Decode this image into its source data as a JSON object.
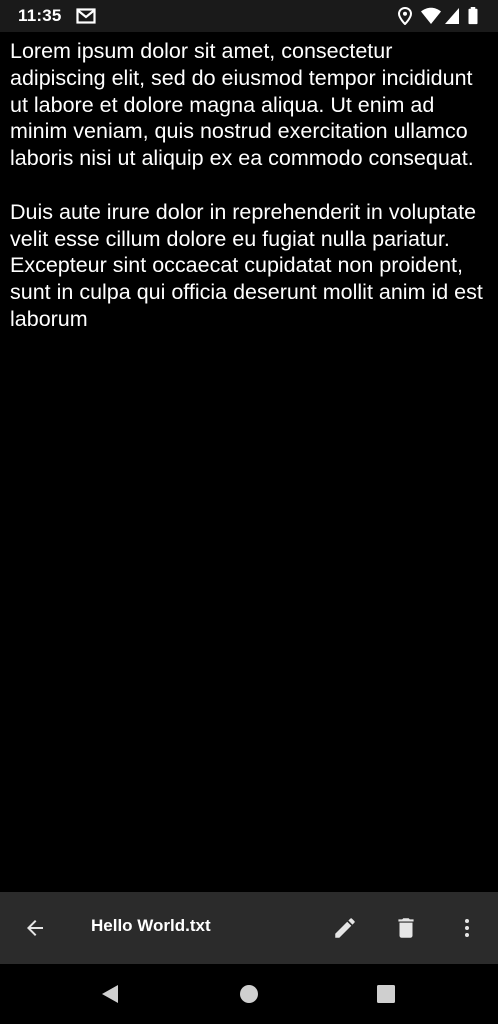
{
  "status_bar": {
    "time": "11:35",
    "icons": [
      "gmail-icon",
      "location-icon",
      "wifi-icon",
      "signal-icon",
      "battery-icon"
    ]
  },
  "document": {
    "paragraphs": [
      "Lorem ipsum dolor sit amet, consectetur adipiscing elit, sed do eiusmod tempor incididunt ut labore et dolore magna aliqua. Ut enim ad minim veniam, quis nostrud exercitation ullamco laboris nisi ut aliquip ex ea commodo consequat.",
      "Duis aute irure dolor in reprehenderit in voluptate velit esse cillum dolore eu fugiat nulla pariatur. Excepteur sint occaecat cupidatat non proident, sunt in culpa qui officia deserunt mollit anim id est laborum"
    ]
  },
  "app_bar": {
    "file_name": "Hello World.txt",
    "icons": [
      "back-arrow-icon",
      "edit-pencil-icon",
      "delete-trash-icon",
      "more-vert-icon"
    ]
  },
  "nav_bar": {
    "icons": [
      "back-triangle-icon",
      "home-circle-icon",
      "recents-square-icon"
    ]
  },
  "colors": {
    "background": "#000000",
    "status_bar": "#1a1a1a",
    "app_bar": "#2b2b2b",
    "text": "#ffffff",
    "icon": "#e6e6e6",
    "nav_icon": "#cfcfcf"
  }
}
